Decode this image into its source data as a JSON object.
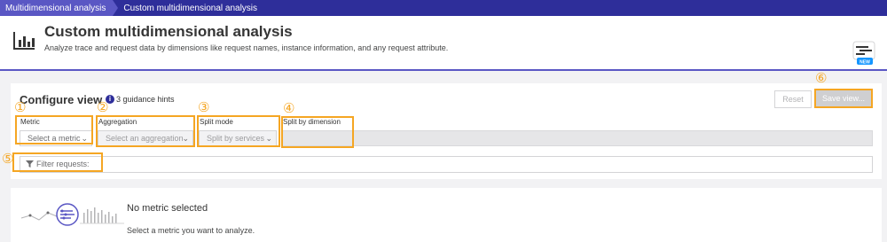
{
  "breadcrumb": {
    "items": [
      "Multidimensional analysis",
      "Custom multidimensional analysis"
    ]
  },
  "header": {
    "title": "Custom multidimensional analysis",
    "subtitle": "Analyze trace and request data by dimensions like request names, instance information, and any request attribute.",
    "icon": "bar-chart-icon",
    "new_badge": "NEW"
  },
  "configure": {
    "title": "Configure view",
    "hints": "3 guidance hints",
    "reset_label": "Reset",
    "save_label": "Save view...",
    "fields": {
      "metric": {
        "label": "Metric",
        "placeholder": "Select a metric"
      },
      "aggregation": {
        "label": "Aggregation",
        "placeholder": "Select an aggregation"
      },
      "split_mode": {
        "label": "Split mode",
        "placeholder": "Split by services"
      },
      "split_dimension": {
        "label": "Split by dimension"
      }
    },
    "filter_placeholder": "Filter requests:"
  },
  "annotations": [
    "①",
    "②",
    "③",
    "④",
    "⑤",
    "⑥"
  ],
  "empty_state": {
    "title": "No metric selected",
    "text": "Select a metric you want to analyze."
  },
  "colors": {
    "brand": "#2e2e9a",
    "accent": "#5a57c4",
    "highlight": "#f5a623"
  }
}
